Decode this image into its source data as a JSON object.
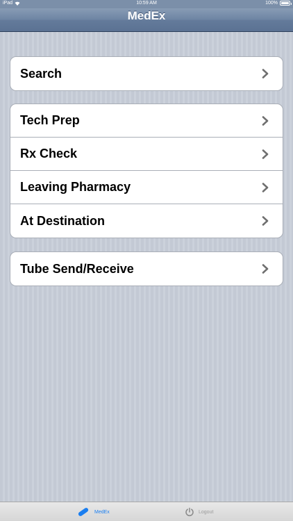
{
  "status_bar": {
    "carrier": "iPad",
    "time": "10:59 AM",
    "battery": "100%",
    "battery_level": 1.0
  },
  "nav": {
    "title": "MedEx"
  },
  "groups": [
    {
      "rows": [
        {
          "label": "Search"
        }
      ]
    },
    {
      "rows": [
        {
          "label": "Tech Prep"
        },
        {
          "label": "Rx Check"
        },
        {
          "label": "Leaving Pharmacy"
        },
        {
          "label": "At Destination"
        }
      ]
    },
    {
      "rows": [
        {
          "label": "Tube Send/Receive"
        }
      ]
    }
  ],
  "tab_bar": {
    "tabs": [
      {
        "label": "MedEx",
        "icon": "pill-icon",
        "selected": true
      },
      {
        "label": "Logout",
        "icon": "power-icon",
        "selected": false
      }
    ]
  },
  "colors": {
    "nav_bar": "#6d84a3",
    "selected_tab": "#1a7ef0",
    "unselected_tab": "#9a9a9a",
    "chevron": "#6f6f6f"
  }
}
